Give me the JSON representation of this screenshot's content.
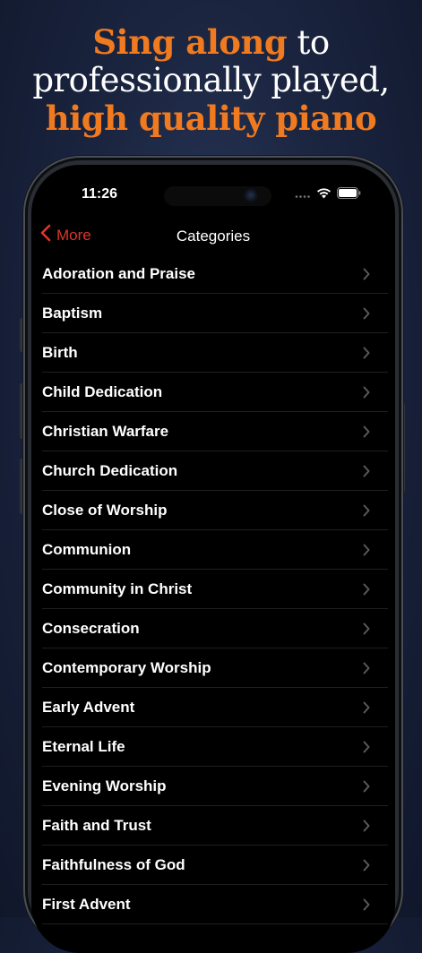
{
  "headline": {
    "part1_accent": "Sing along",
    "part1_rest": " to",
    "line2": "professionally played,",
    "line3_accent": "high quality piano"
  },
  "status_bar": {
    "time": "11:26"
  },
  "nav": {
    "back_label": "More",
    "title": "Categories"
  },
  "categories": [
    "Adoration and Praise",
    "Baptism",
    "Birth",
    "Child Dedication",
    "Christian Warfare",
    "Church Dedication",
    "Close of Worship",
    "Communion",
    "Community in Christ",
    "Consecration",
    "Contemporary Worship",
    "Early Advent",
    "Eternal Life",
    "Evening Worship",
    "Faith and Trust",
    "Faithfulness of God",
    "First Advent"
  ],
  "colors": {
    "accent": "#f07a1f",
    "back_red": "#e0342c"
  }
}
